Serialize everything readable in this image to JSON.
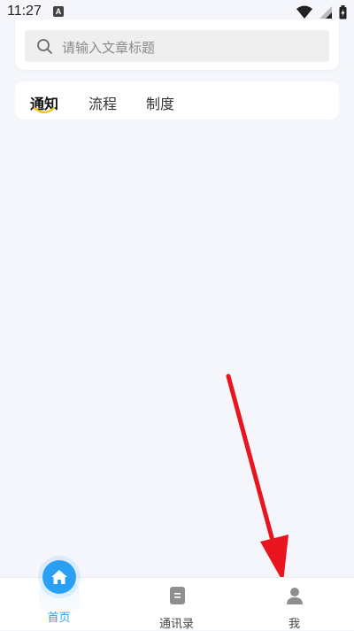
{
  "status_bar": {
    "time": "11:27",
    "notification_icon": "A"
  },
  "search": {
    "placeholder": "请输入文章标题"
  },
  "tabs": [
    {
      "label": "通知",
      "active": true
    },
    {
      "label": "流程",
      "active": false
    },
    {
      "label": "制度",
      "active": false
    }
  ],
  "bottom_nav": {
    "items": [
      {
        "label": "首页",
        "icon": "home-icon",
        "active": true
      },
      {
        "label": "通讯录",
        "icon": "contacts-icon",
        "active": false
      },
      {
        "label": "我",
        "icon": "person-icon",
        "active": false
      }
    ]
  },
  "colors": {
    "accent": "#2aa0f4",
    "background": "#f4f6fb",
    "annotation": "#e8141e",
    "tab_underline": "#f5c518"
  }
}
